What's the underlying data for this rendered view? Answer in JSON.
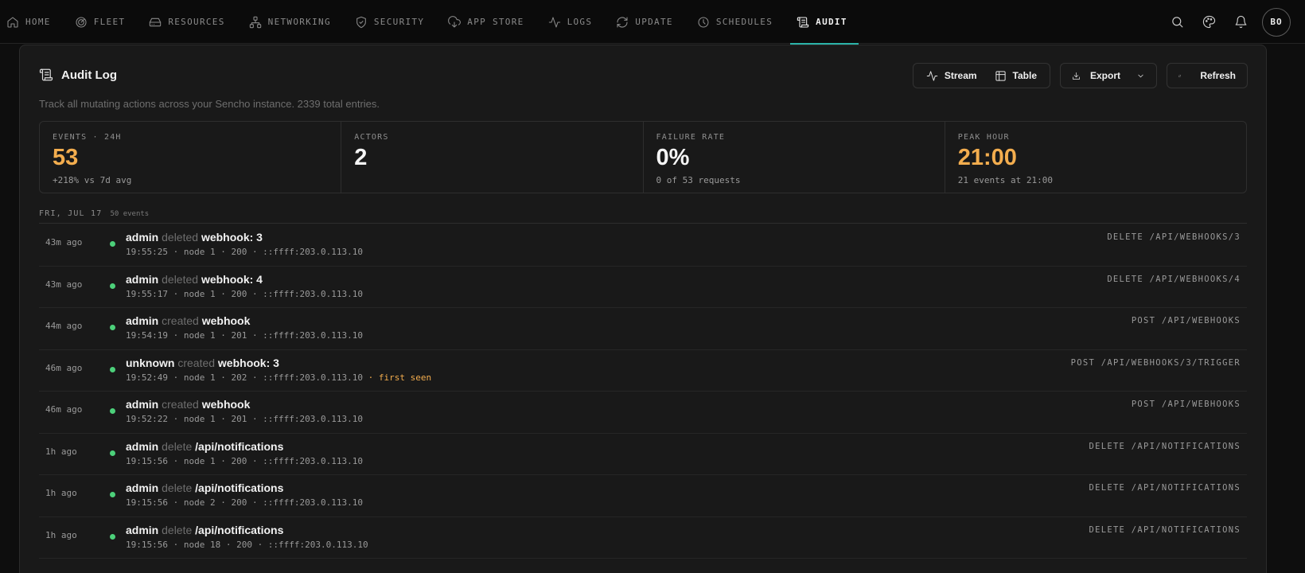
{
  "nav": {
    "tabs": [
      {
        "label": "HOME",
        "icon": "home-icon"
      },
      {
        "label": "FLEET",
        "icon": "fleet-icon"
      },
      {
        "label": "RESOURCES",
        "icon": "hard-drive-icon"
      },
      {
        "label": "NETWORKING",
        "icon": "network-icon"
      },
      {
        "label": "SECURITY",
        "icon": "shield-icon"
      },
      {
        "label": "APP STORE",
        "icon": "cloud-download-icon"
      },
      {
        "label": "LOGS",
        "icon": "activity-icon"
      },
      {
        "label": "UPDATE",
        "icon": "refresh-icon"
      },
      {
        "label": "SCHEDULES",
        "icon": "clock-icon"
      },
      {
        "label": "AUDIT",
        "icon": "scroll-icon"
      }
    ],
    "active_tab": "AUDIT",
    "avatar_initials": "BO"
  },
  "panel": {
    "title": "Audit Log",
    "subtitle": "Track all mutating actions across your Sencho instance. 2339 total entries.",
    "toolbar": {
      "stream_label": "Stream",
      "table_label": "Table",
      "export_label": "Export",
      "refresh_label": "Refresh"
    }
  },
  "stats": [
    {
      "label": "EVENTS · 24H",
      "value": "53",
      "note": "+218% vs 7d avg",
      "accent": true
    },
    {
      "label": "ACTORS",
      "value": "2",
      "note": "",
      "accent": false
    },
    {
      "label": "FAILURE RATE",
      "value": "0%",
      "note": "0 of 53 requests",
      "accent": false
    },
    {
      "label": "PEAK HOUR",
      "value": "21:00",
      "note": "21 events at 21:00",
      "accent": true
    }
  ],
  "day_group": {
    "label": "FRI, JUL 17",
    "count": "50 events"
  },
  "rows": [
    {
      "ago": "43m ago",
      "actor": "admin",
      "verb": "deleted",
      "target": "webhook: 3",
      "meta": "19:55:25 · node 1 · 200 · ::ffff:203.0.113.10",
      "flag": "",
      "route": "DELETE /API/WEBHOOKS/3"
    },
    {
      "ago": "43m ago",
      "actor": "admin",
      "verb": "deleted",
      "target": "webhook: 4",
      "meta": "19:55:17 · node 1 · 200 · ::ffff:203.0.113.10",
      "flag": "",
      "route": "DELETE /API/WEBHOOKS/4"
    },
    {
      "ago": "44m ago",
      "actor": "admin",
      "verb": "created",
      "target": "webhook",
      "meta": "19:54:19 · node 1 · 201 · ::ffff:203.0.113.10",
      "flag": "",
      "route": "POST /API/WEBHOOKS"
    },
    {
      "ago": "46m ago",
      "actor": "unknown",
      "verb": "created",
      "target": "webhook: 3",
      "meta": "19:52:49 · node 1 · 202 · ::ffff:203.0.113.10",
      "flag": " · first seen",
      "route": "POST /API/WEBHOOKS/3/TRIGGER"
    },
    {
      "ago": "46m ago",
      "actor": "admin",
      "verb": "created",
      "target": "webhook",
      "meta": "19:52:22 · node 1 · 201 · ::ffff:203.0.113.10",
      "flag": "",
      "route": "POST /API/WEBHOOKS"
    },
    {
      "ago": "1h ago",
      "actor": "admin",
      "verb": "delete",
      "target": "/api/notifications",
      "meta": "19:15:56 · node 1 · 200 · ::ffff:203.0.113.10",
      "flag": "",
      "route": "DELETE /API/NOTIFICATIONS"
    },
    {
      "ago": "1h ago",
      "actor": "admin",
      "verb": "delete",
      "target": "/api/notifications",
      "meta": "19:15:56 · node 2 · 200 · ::ffff:203.0.113.10",
      "flag": "",
      "route": "DELETE /API/NOTIFICATIONS"
    },
    {
      "ago": "1h ago",
      "actor": "admin",
      "verb": "delete",
      "target": "/api/notifications",
      "meta": "19:15:56 · node 18 · 200 · ::ffff:203.0.113.10",
      "flag": "",
      "route": "DELETE /API/NOTIFICATIONS"
    }
  ],
  "colors": {
    "accent": "#f3ad4e",
    "active_underline": "#2bb3a8",
    "status_ok": "#4cd07a"
  }
}
